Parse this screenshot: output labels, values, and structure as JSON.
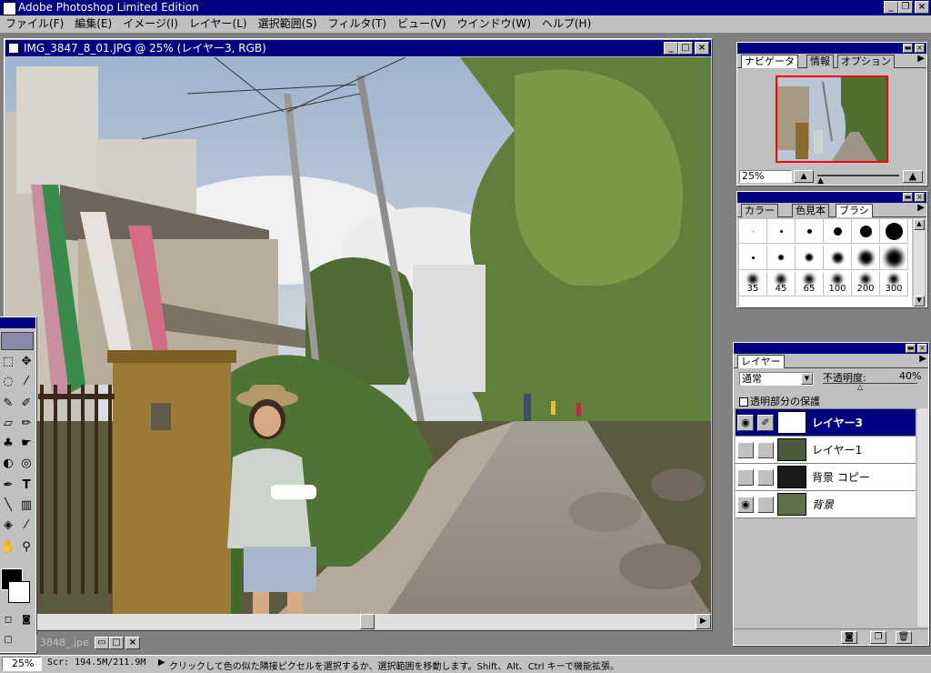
{
  "app": {
    "title": "Adobe Photoshop Limited Edition",
    "window_controls": [
      "_",
      "❐",
      "×"
    ]
  },
  "menu": [
    "ファイル(F)",
    "編集(E)",
    "イメージ(I)",
    "レイヤー(L)",
    "選択範囲(S)",
    "フィルタ(T)",
    "ビュー(V)",
    "ウインドウ(W)",
    "ヘルプ(H)"
  ],
  "document": {
    "title": "IMG_3847_8_01.JPG @ 25% (レイヤー3, RGB)",
    "controls": [
      "_",
      "□",
      "×"
    ],
    "zoom_percent": 25
  },
  "minimized_doc": {
    "title": "3848_.jpe"
  },
  "navigator": {
    "tabs": [
      "ナビゲータ",
      "情報",
      "オプション"
    ],
    "active_tab": "ナビゲータ",
    "zoom_value": "25%"
  },
  "brushes": {
    "tabs": [
      "カラー",
      "色見本",
      "ブラシ"
    ],
    "active_tab": "ブラシ",
    "labels": [
      "35",
      "45",
      "65",
      "100",
      "200",
      "300"
    ]
  },
  "layers": {
    "tab": "レイヤー",
    "blend_mode": "通常",
    "opacity_label": "不透明度:",
    "opacity_value": "40%",
    "preserve_label": "透明部分の保護",
    "items": [
      {
        "name": "レイヤー3",
        "visible": true,
        "selected": true
      },
      {
        "name": "レイヤー1",
        "visible": false,
        "selected": false
      },
      {
        "name": "背景 コピー",
        "visible": false,
        "selected": false
      },
      {
        "name": "背景",
        "visible": true,
        "selected": false
      }
    ]
  },
  "status": {
    "zoom": "25%",
    "scratch": "Scr: 194.5M/211.9M",
    "hint": "クリックして色の似た隣接ピクセルを選択するか、選択範囲を移動します。Shift、Alt、Ctrl キーで機能拡張。"
  },
  "colors": {
    "title_active": "#000080",
    "chrome": "#c0c0c0",
    "workspace": "#808080",
    "accent_red": "#ff0000"
  },
  "icons": [
    "eye-icon",
    "paintbrush-icon",
    "marquee-icon",
    "move-icon",
    "lasso-icon",
    "magic-wand-icon",
    "airbrush-icon",
    "pencil-icon",
    "rubber-stamp-icon",
    "text-icon",
    "gradient-icon",
    "eyedropper-icon",
    "hand-icon",
    "zoom-icon"
  ]
}
